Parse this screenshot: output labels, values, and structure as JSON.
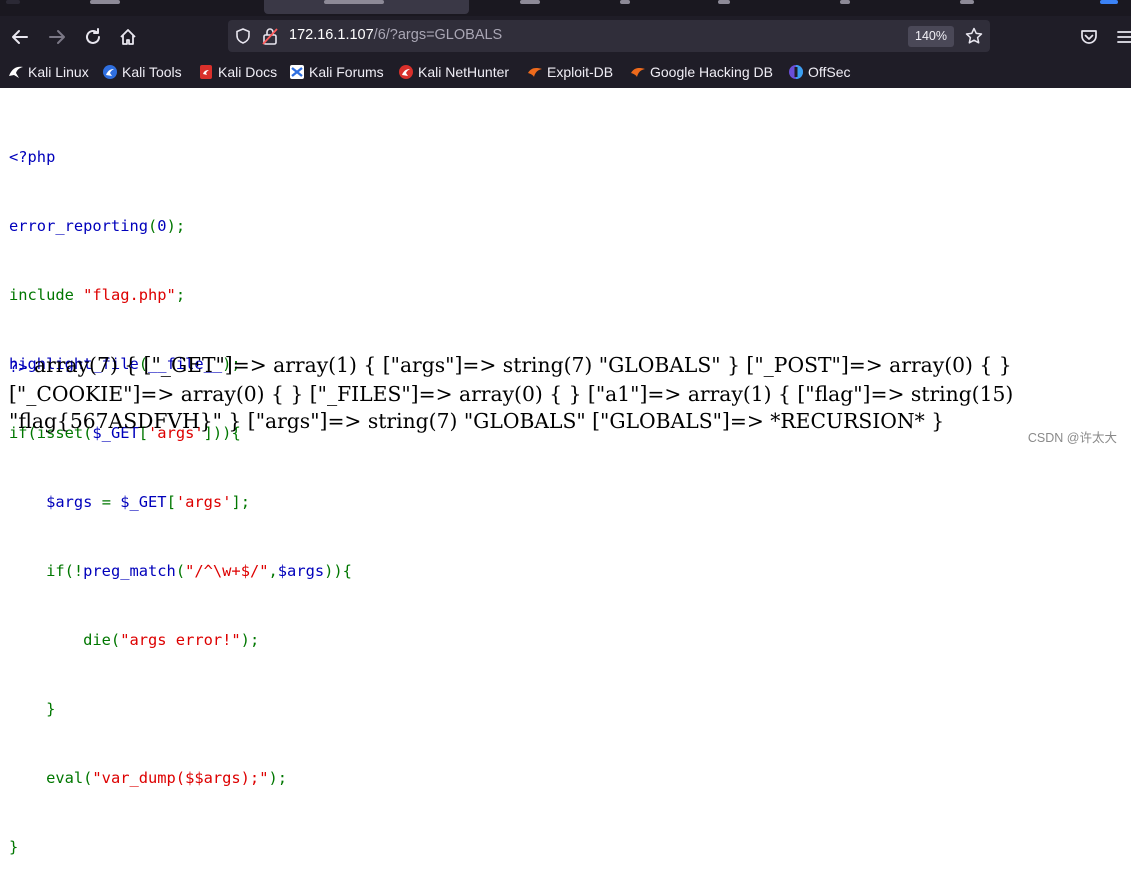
{
  "browser": {
    "url_host": "172.16.1.107",
    "url_path": "/6/?args=GLOBALS",
    "zoom": "140%",
    "bookmarks": [
      {
        "label": "Kali Linux",
        "icon": "kali-dragon-icon"
      },
      {
        "label": "Kali Tools",
        "icon": "kali-tools-icon"
      },
      {
        "label": "Kali Docs",
        "icon": "kali-docs-icon"
      },
      {
        "label": "Kali Forums",
        "icon": "kali-forums-icon"
      },
      {
        "label": "Kali NetHunter",
        "icon": "nethunter-icon"
      },
      {
        "label": "Exploit-DB",
        "icon": "exploit-db-icon"
      },
      {
        "label": "Google Hacking DB",
        "icon": "ghdb-icon"
      },
      {
        "label": "OffSec",
        "icon": "offsec-icon"
      }
    ]
  },
  "code": {
    "l1": "<?php",
    "l2a": "error_reporting",
    "l2b": "(",
    "l2c": "0",
    "l2d": ");",
    "l3a": "include ",
    "l3b": "\"flag.php\"",
    "l3c": ";",
    "l4a": "highlight_file",
    "l4b": "(",
    "l4c": "__file__",
    "l4d": ");",
    "l5a": "if(isset(",
    "l5b": "$_GET",
    "l5c": "[",
    "l5d": "'args'",
    "l5e": "])){",
    "l6a": "    ",
    "l6b": "$args ",
    "l6c": "= ",
    "l6d": "$_GET",
    "l6e": "[",
    "l6f": "'args'",
    "l6g": "];",
    "l7a": "    if(!",
    "l7b": "preg_match",
    "l7c": "(",
    "l7d": "\"/^\\w+$/\"",
    "l7e": ",",
    "l7f": "$args",
    "l7g": ")){",
    "l8a": "        die(",
    "l8b": "\"args error!\"",
    "l8c": ");",
    "l9": "    }",
    "l10a": "    eval(",
    "l10b": "\"var_dump($$args);\"",
    "l10c": ");",
    "l11": "}",
    "l12": "?>"
  },
  "output": {
    "dump": "array(7) { [\"_GET\"]=> array(1) { [\"args\"]=> string(7) \"GLOBALS\" } [\"_POST\"]=> array(0) { } [\"_COOKIE\"]=> array(0) { } [\"_FILES\"]=> array(0) { } [\"a1\"]=> array(1) { [\"flag\"]=> string(15) \"flag{567ASDFVH}\" } [\"args\"]=> string(7) \"GLOBALS\" [\"GLOBALS\"]=> *RECURSION* }"
  },
  "watermark": "CSDN @许太大",
  "colors": {
    "php_keyword": "#007700",
    "php_string": "#dd0000",
    "php_default": "#0000bb",
    "chrome_bg": "#1f1d27"
  }
}
